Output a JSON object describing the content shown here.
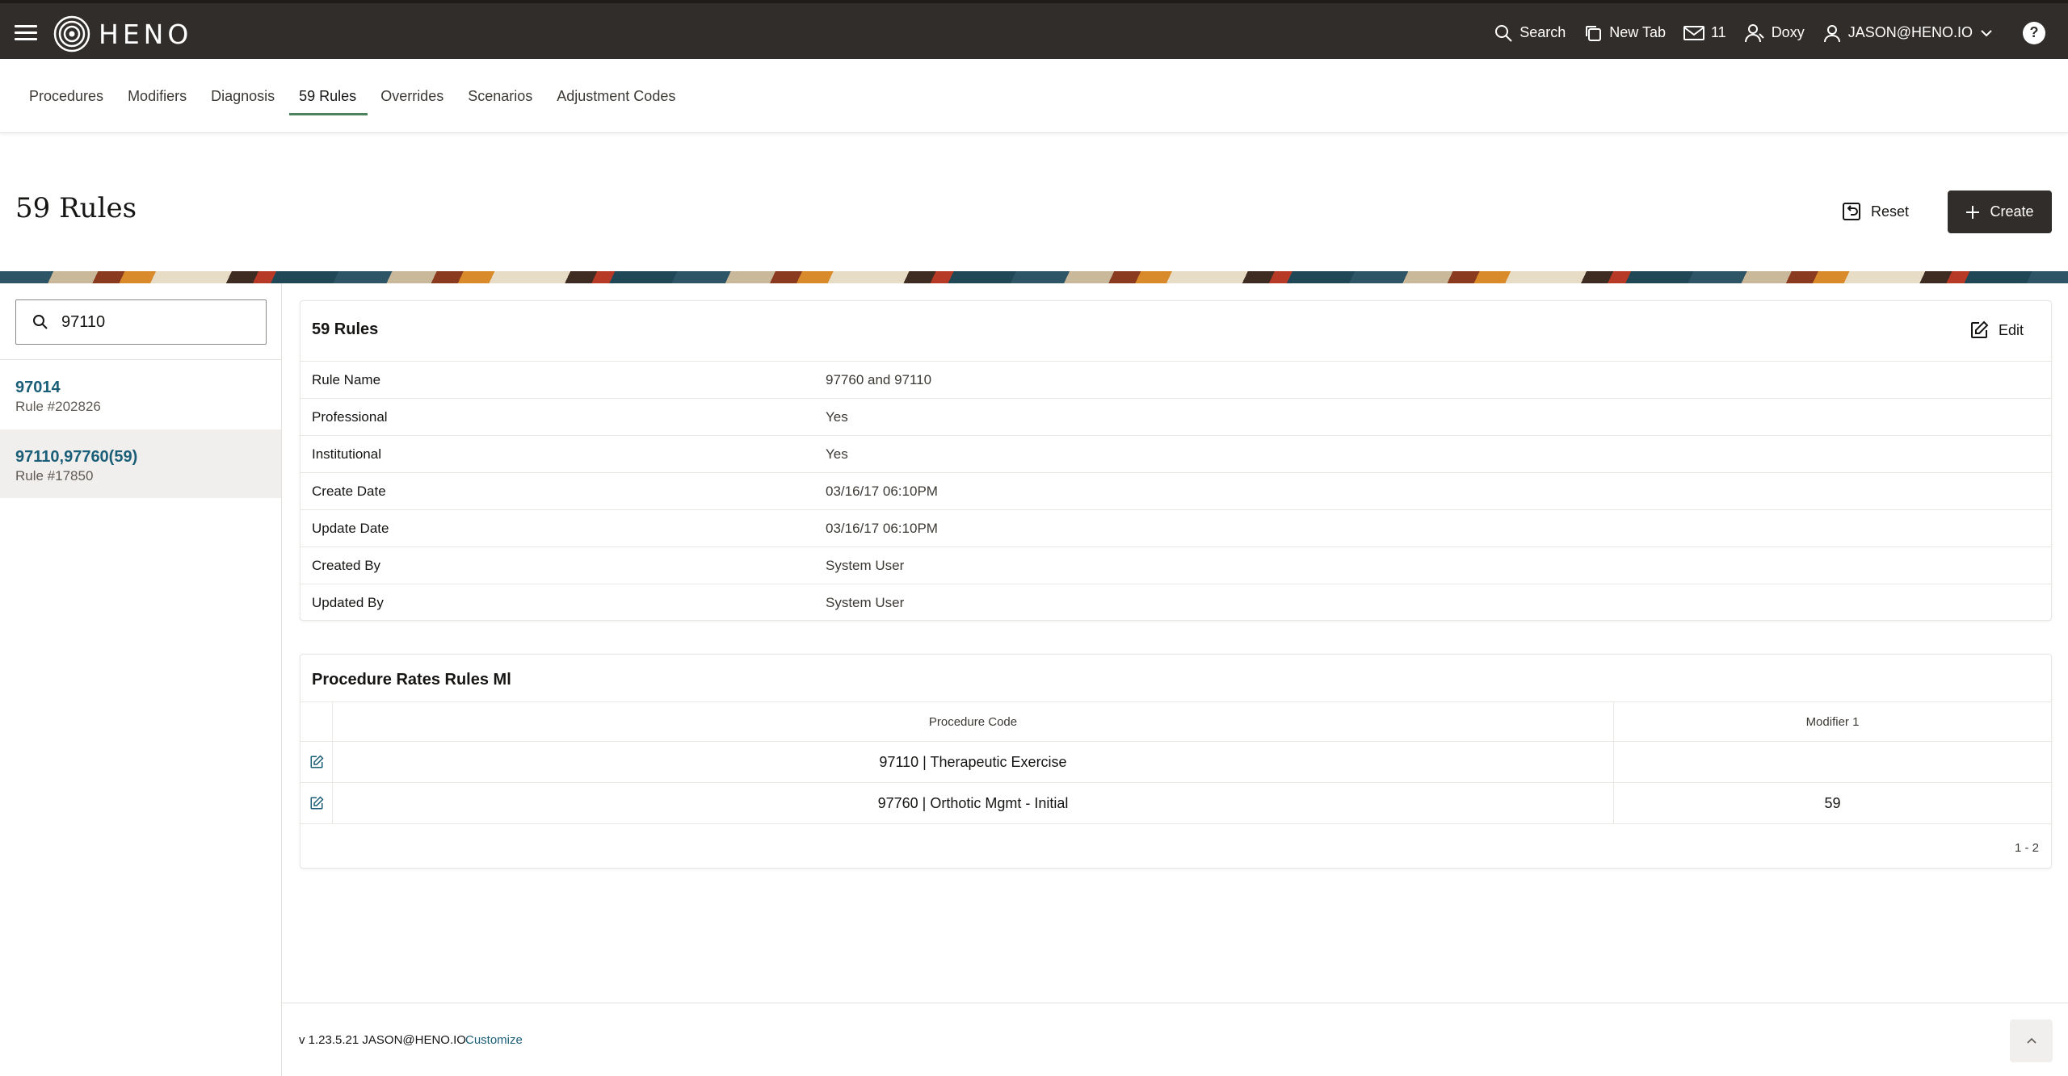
{
  "topbar": {
    "logo_text": "HENO",
    "search_label": "Search",
    "new_tab_label": "New Tab",
    "mail_count": "11",
    "doxy_label": "Doxy",
    "user_label": "JASON@HENO.IO",
    "help_label": "?"
  },
  "subnav": {
    "tabs": [
      {
        "label": "Procedures"
      },
      {
        "label": "Modifiers"
      },
      {
        "label": "Diagnosis"
      },
      {
        "label": "59 Rules"
      },
      {
        "label": "Overrides"
      },
      {
        "label": "Scenarios"
      },
      {
        "label": "Adjustment Codes"
      }
    ],
    "active": "59 Rules"
  },
  "page": {
    "title": "59 Rules",
    "reset_label": "Reset",
    "create_label": "Create"
  },
  "sidebar": {
    "search_value": "97110",
    "items": [
      {
        "code": "97014",
        "rule": "Rule #202826"
      },
      {
        "code": "97110,97760(59)",
        "rule": "Rule #17850"
      }
    ],
    "selected_index": 1
  },
  "details": {
    "title": "59 Rules",
    "edit_label": "Edit",
    "rows": [
      {
        "label": "Rule Name",
        "value": "97760 and 97110"
      },
      {
        "label": "Professional",
        "value": "Yes"
      },
      {
        "label": "Institutional",
        "value": "Yes"
      },
      {
        "label": "Create Date",
        "value": "03/16/17 06:10PM"
      },
      {
        "label": "Update Date",
        "value": "03/16/17 06:10PM"
      },
      {
        "label": "Created By",
        "value": "System User"
      },
      {
        "label": "Updated By",
        "value": "System User"
      }
    ]
  },
  "rates": {
    "title": "Procedure Rates Rules Ml",
    "columns": [
      "Procedure Code",
      "Modifier 1"
    ],
    "rows": [
      {
        "procedure": "97110 | Therapeutic Exercise",
        "modifier": ""
      },
      {
        "procedure": "97760 | Orthotic Mgmt - Initial",
        "modifier": "59"
      }
    ],
    "pager": "1 - 2"
  },
  "footer": {
    "version": "v 1.23.5.21 JASON@HENO.IO",
    "customize_label": "Customize"
  }
}
